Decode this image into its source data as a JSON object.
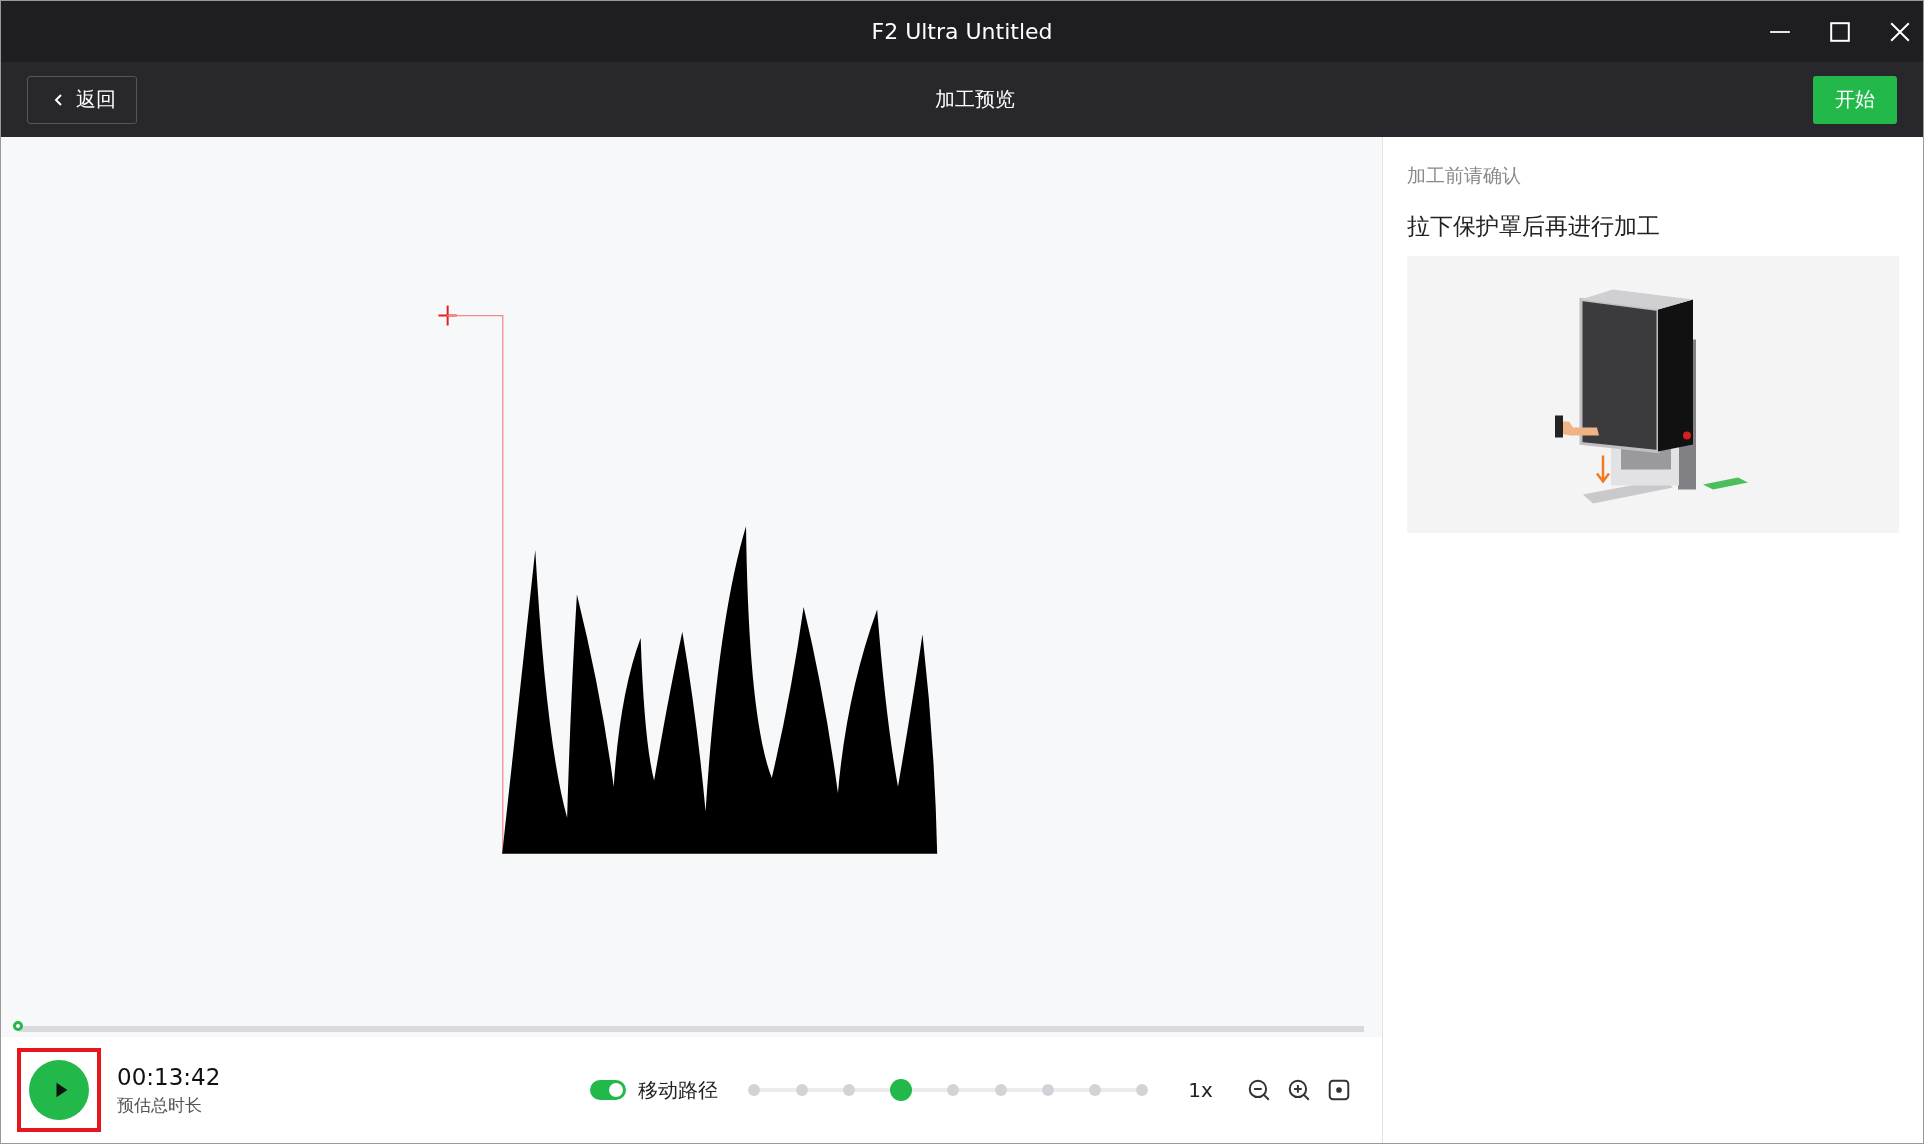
{
  "window": {
    "title": "F2 Ultra Untitled"
  },
  "toolbar": {
    "back_button": "返回",
    "title": "加工预览",
    "start_button": "开始"
  },
  "preview": {
    "progress": {
      "level": 0
    },
    "estimated_time": {
      "value": "00:13:42",
      "label": "预估总时长"
    },
    "move_path": {
      "label": "移动路径",
      "on": true
    },
    "speed": {
      "level": 0.375,
      "reading": "1x"
    }
  },
  "notice": {
    "heading": "加工前请确认",
    "message": "拉下保护罩后再进行加工"
  }
}
